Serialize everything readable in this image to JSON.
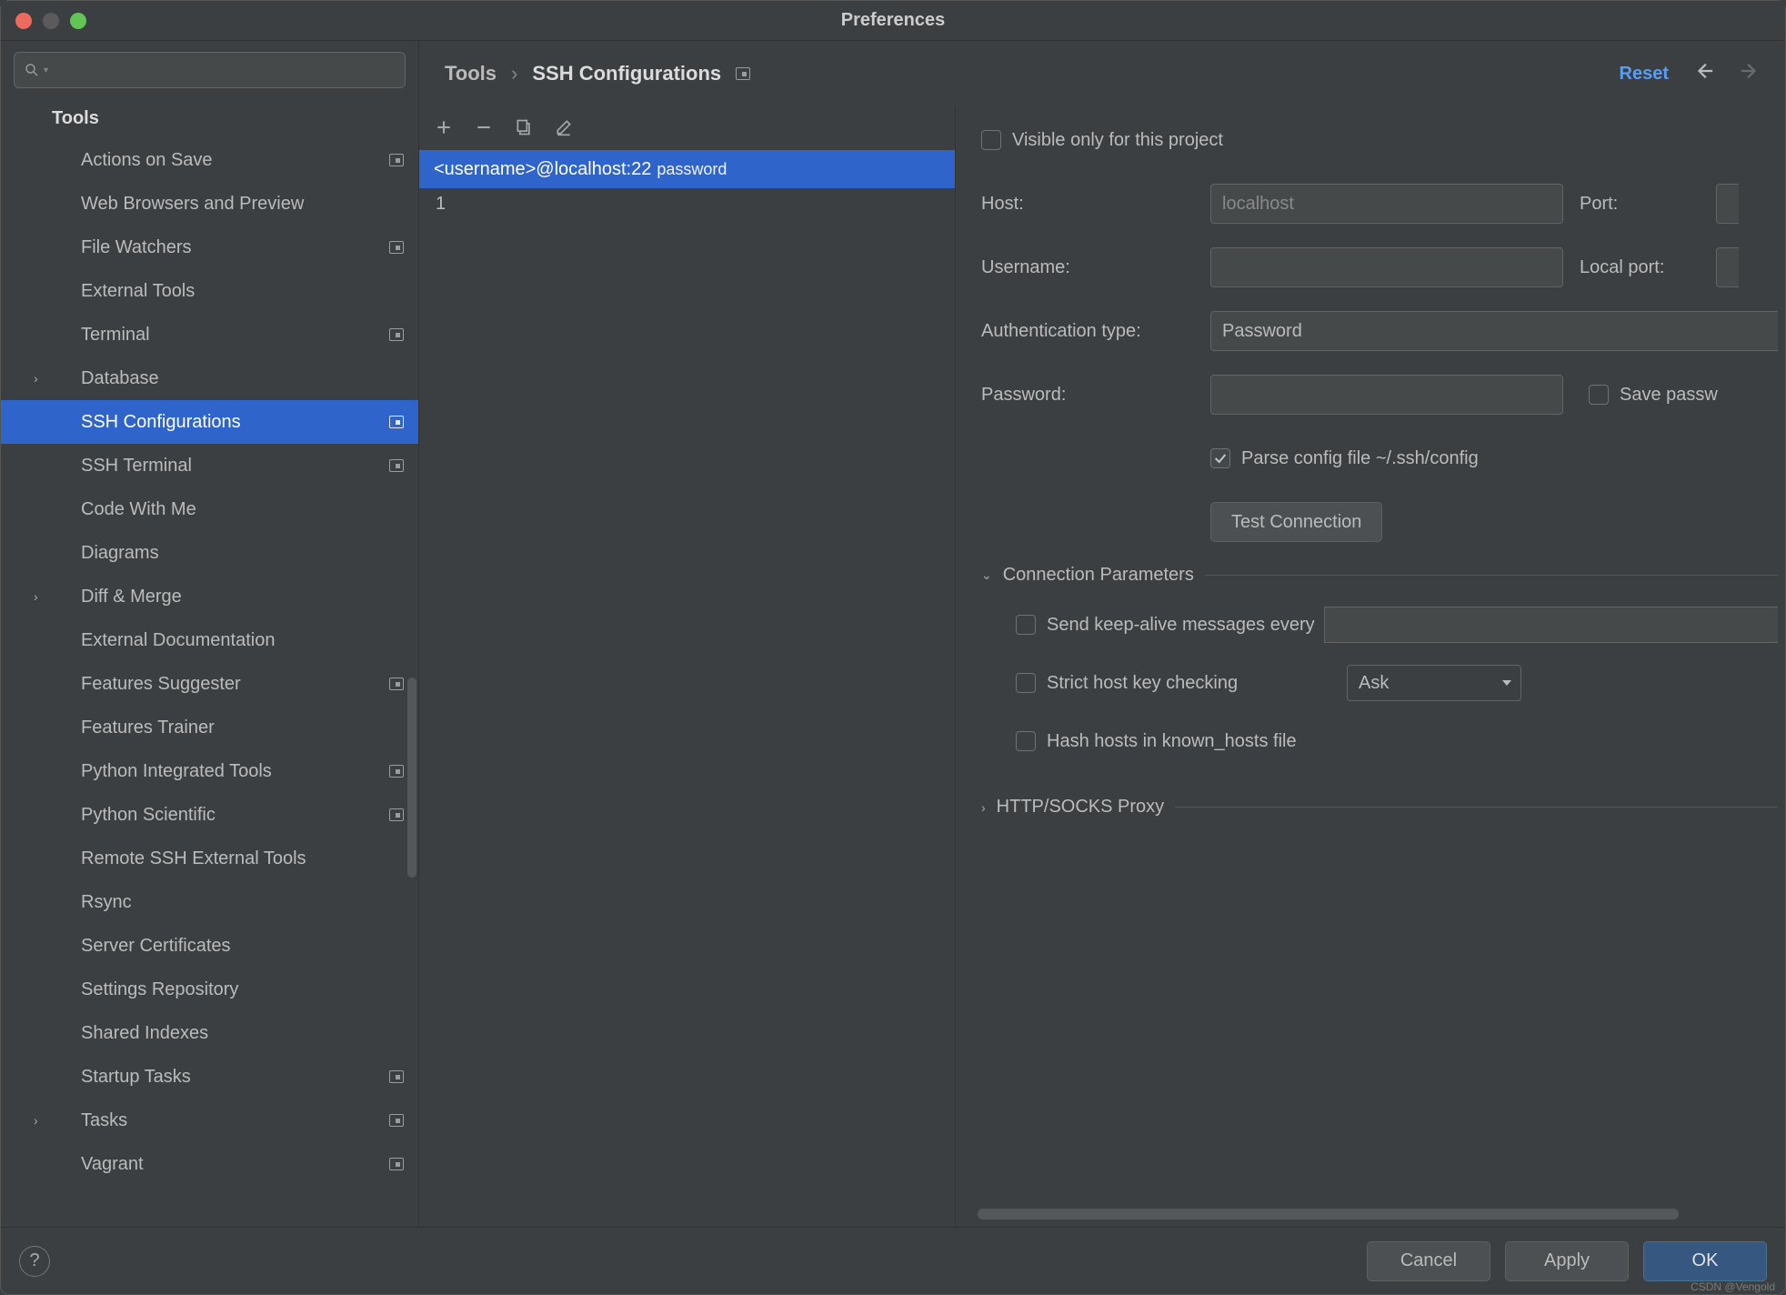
{
  "window": {
    "title": "Preferences"
  },
  "breadcrumb": {
    "root": "Tools",
    "page": "SSH Configurations",
    "reset": "Reset"
  },
  "sidebar": {
    "heading": "Tools",
    "items": [
      {
        "label": "Actions on Save",
        "project": true
      },
      {
        "label": "Web Browsers and Preview"
      },
      {
        "label": "File Watchers",
        "project": true
      },
      {
        "label": "External Tools"
      },
      {
        "label": "Terminal",
        "project": true
      },
      {
        "label": "Database",
        "expandable": true
      },
      {
        "label": "SSH Configurations",
        "project": true,
        "selected": true
      },
      {
        "label": "SSH Terminal",
        "project": true
      },
      {
        "label": "Code With Me"
      },
      {
        "label": "Diagrams"
      },
      {
        "label": "Diff & Merge",
        "expandable": true
      },
      {
        "label": "External Documentation"
      },
      {
        "label": "Features Suggester",
        "project": true
      },
      {
        "label": "Features Trainer"
      },
      {
        "label": "Python Integrated Tools",
        "project": true
      },
      {
        "label": "Python Scientific",
        "project": true
      },
      {
        "label": "Remote SSH External Tools"
      },
      {
        "label": "Rsync"
      },
      {
        "label": "Server Certificates"
      },
      {
        "label": "Settings Repository"
      },
      {
        "label": "Shared Indexes"
      },
      {
        "label": "Startup Tasks",
        "project": true
      },
      {
        "label": "Tasks",
        "expandable": true,
        "project": true
      },
      {
        "label": "Vagrant",
        "project": true
      }
    ]
  },
  "list": {
    "items": [
      {
        "title": "<username>@localhost:22",
        "subtitle": "password",
        "selected": true
      }
    ],
    "count": "1"
  },
  "form": {
    "visible_only_label": "Visible only for this project",
    "visible_only_checked": false,
    "host_label": "Host:",
    "host_placeholder": "localhost",
    "host_value": "",
    "port_label": "Port:",
    "username_label": "Username:",
    "username_value": "",
    "localport_label": "Local port:",
    "auth_label": "Authentication type:",
    "auth_value": "Password",
    "password_label": "Password:",
    "password_value": "",
    "save_password_label": "Save passw",
    "save_password_checked": false,
    "parse_config_label": "Parse config file ~/.ssh/config",
    "parse_config_checked": true,
    "test_connection": "Test Connection",
    "section_conn_params": "Connection Parameters",
    "keepalive_label": "Send keep-alive messages every",
    "keepalive_checked": false,
    "strict_label": "Strict host key checking",
    "strict_checked": false,
    "strict_value": "Ask",
    "hash_hosts_label": "Hash hosts in known_hosts file",
    "hash_hosts_checked": false,
    "section_proxy": "HTTP/SOCKS Proxy"
  },
  "footer": {
    "cancel": "Cancel",
    "apply": "Apply",
    "ok": "OK"
  },
  "watermark": "CSDN @Vengold"
}
